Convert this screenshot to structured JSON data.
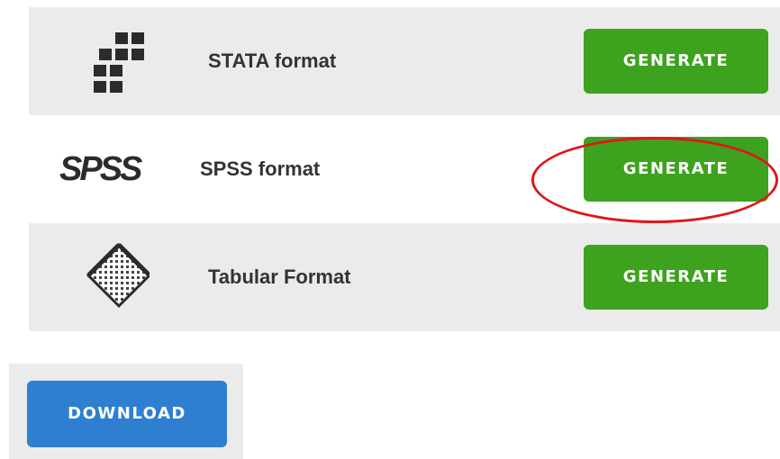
{
  "formats": [
    {
      "label": "STATA format",
      "button": "GENERATE",
      "icon": "stata-grid-icon"
    },
    {
      "label": "SPSS format",
      "button": "GENERATE",
      "icon": "spss-logo",
      "logo_text": "SPSS"
    },
    {
      "label": "Tabular Format",
      "button": "GENERATE",
      "icon": "tabular-grid-icon"
    }
  ],
  "download": {
    "label": "DOWNLOAD"
  },
  "colors": {
    "generate_button": "#3da21e",
    "download_button": "#2f7fd0",
    "row_shade": "#ebebeb",
    "highlight": "#e0161c"
  }
}
